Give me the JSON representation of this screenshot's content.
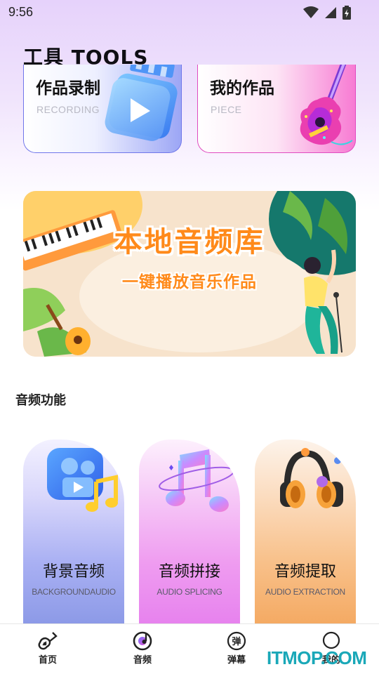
{
  "status_bar": {
    "time": "9:56"
  },
  "tools": {
    "title": "工具 TOOLS",
    "cards": [
      {
        "title": "作品录制",
        "subtitle": "RECORDING"
      },
      {
        "title": "我的作品",
        "subtitle": "PIECE"
      }
    ]
  },
  "banner": {
    "title": "本地音频库",
    "subtitle": "一键播放音乐作品"
  },
  "audio_section": {
    "label": "音频功能",
    "features": [
      {
        "title": "背景音频",
        "subtitle": "BACKGROUNDAUDIO"
      },
      {
        "title": "音频拼接",
        "subtitle": "AUDIO SPLICING"
      },
      {
        "title": "音频提取",
        "subtitle": "AUDIO EXTRACTION"
      }
    ]
  },
  "bottom_nav": {
    "items": [
      {
        "label": "首页",
        "icon": "guitar-icon"
      },
      {
        "label": "音频",
        "icon": "vinyl-icon"
      },
      {
        "label": "弹幕",
        "icon": "danmu-icon"
      },
      {
        "label": "我的",
        "icon": "profile-icon"
      }
    ],
    "active_index": 1
  },
  "watermark": "ITMOP.COM",
  "colors": {
    "recording_accent": "#7076ea",
    "piece_accent": "#e04bc0",
    "banner_text": "#ff8a1a",
    "watermark": "#1aa8b8"
  }
}
